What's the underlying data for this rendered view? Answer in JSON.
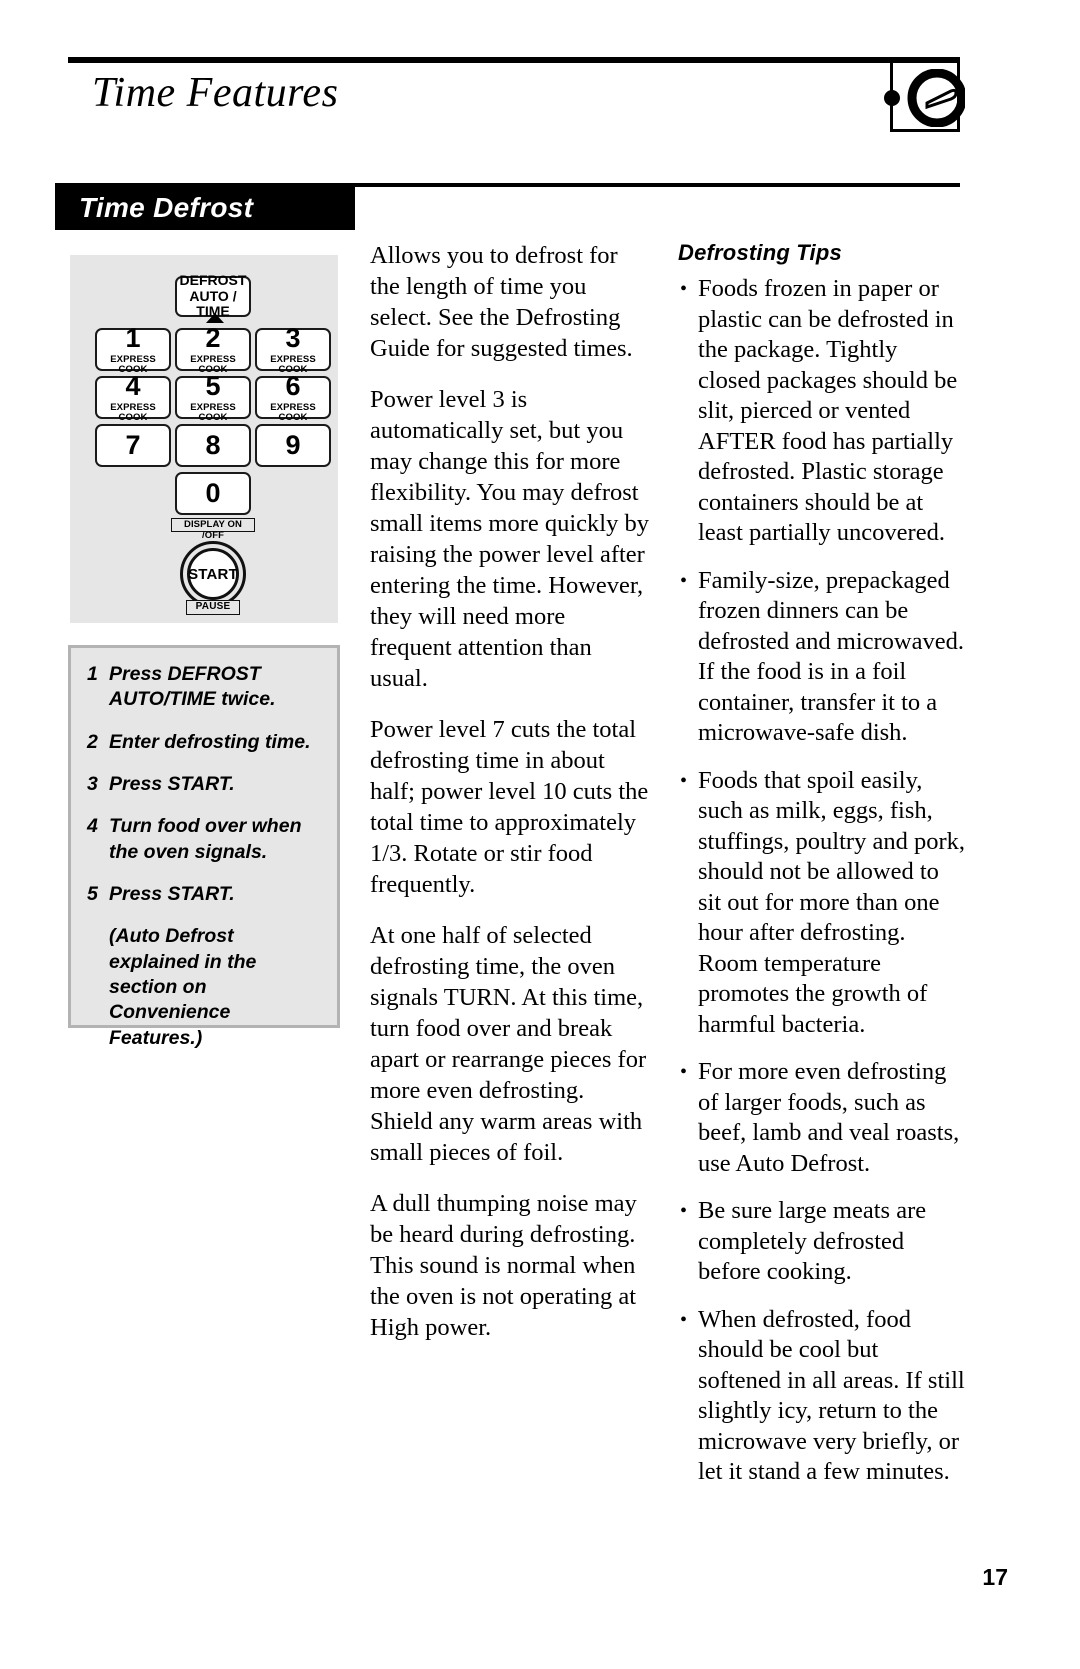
{
  "header": {
    "title": "Time Features",
    "badge_icon": "microwave-dial-icon"
  },
  "section": {
    "title": "Time Defrost"
  },
  "keypad": {
    "defrost_button": {
      "line1": "DEFROST",
      "line2": "AUTO / TIME"
    },
    "keys": [
      {
        "num": "1",
        "sub": "EXPRESS COOK"
      },
      {
        "num": "2",
        "sub": "EXPRESS COOK"
      },
      {
        "num": "3",
        "sub": "EXPRESS COOK"
      },
      {
        "num": "4",
        "sub": "EXPRESS COOK"
      },
      {
        "num": "5",
        "sub": "EXPRESS COOK"
      },
      {
        "num": "6",
        "sub": "EXPRESS COOK"
      },
      {
        "num": "7",
        "sub": ""
      },
      {
        "num": "8",
        "sub": ""
      },
      {
        "num": "9",
        "sub": ""
      }
    ],
    "zero_key": "0",
    "display_toggle": "DISPLAY ON /OFF",
    "start_button": "START",
    "pause_label": "PAUSE"
  },
  "steps": [
    {
      "n": "1",
      "text": "Press DEFROST AUTO/TIME twice."
    },
    {
      "n": "2",
      "text": "Enter defrosting time."
    },
    {
      "n": "3",
      "text": "Press START."
    },
    {
      "n": "4",
      "text": "Turn food over when the oven signals."
    },
    {
      "n": "5",
      "text": "Press START."
    }
  ],
  "steps_note": "(Auto Defrost explained in the section on Convenience Features.)",
  "middle_column": {
    "paragraphs": [
      "Allows you to defrost for the length of time you select. See the Defrosting Guide for suggested times.",
      "Power level 3 is automatically set, but you may change this for more flexibility. You may defrost small items more quickly by raising the power level after entering the time. However, they will need more frequent attention than usual.",
      "Power level 7 cuts the total defrosting time in about half; power level 10 cuts the total time to approximately 1/3. Rotate or stir food frequently.",
      "At one half of selected defrosting time, the oven signals TURN. At this time, turn food over and break apart or rearrange pieces for more even defrosting. Shield any warm areas with small pieces of foil.",
      "A dull thumping noise may be heard during defrosting. This sound is normal when the oven is not operating at High power."
    ]
  },
  "right_column": {
    "heading": "Defrosting Tips",
    "bullet": "•",
    "tips": [
      "Foods frozen in paper or plastic can be defrosted in the package. Tightly closed packages should be slit, pierced or vented AFTER food has partially defrosted. Plastic storage containers should be at least partially uncovered.",
      "Family-size, prepackaged frozen dinners can be defrosted and microwaved. If the food is in a foil container, transfer it to a microwave-safe dish.",
      "Foods that spoil easily, such as milk, eggs, fish, stuffings, poultry and pork, should not be allowed to sit out for more than one hour after defrosting. Room temperature promotes the growth of harmful bacteria.",
      "For more even defrosting of larger foods, such as beef, lamb and veal roasts, use Auto Defrost.",
      "Be sure large meats are completely defrosted before cooking.",
      "When defrosted, food should be cool but softened in all areas. If still slightly icy, return to the microwave very briefly, or let it stand a few minutes."
    ]
  },
  "footer": {
    "page_number": "17"
  },
  "colors": {
    "panel_gray": "#e6e6e6",
    "box_border_gray": "#b3b3b3",
    "ink": "#000000"
  }
}
